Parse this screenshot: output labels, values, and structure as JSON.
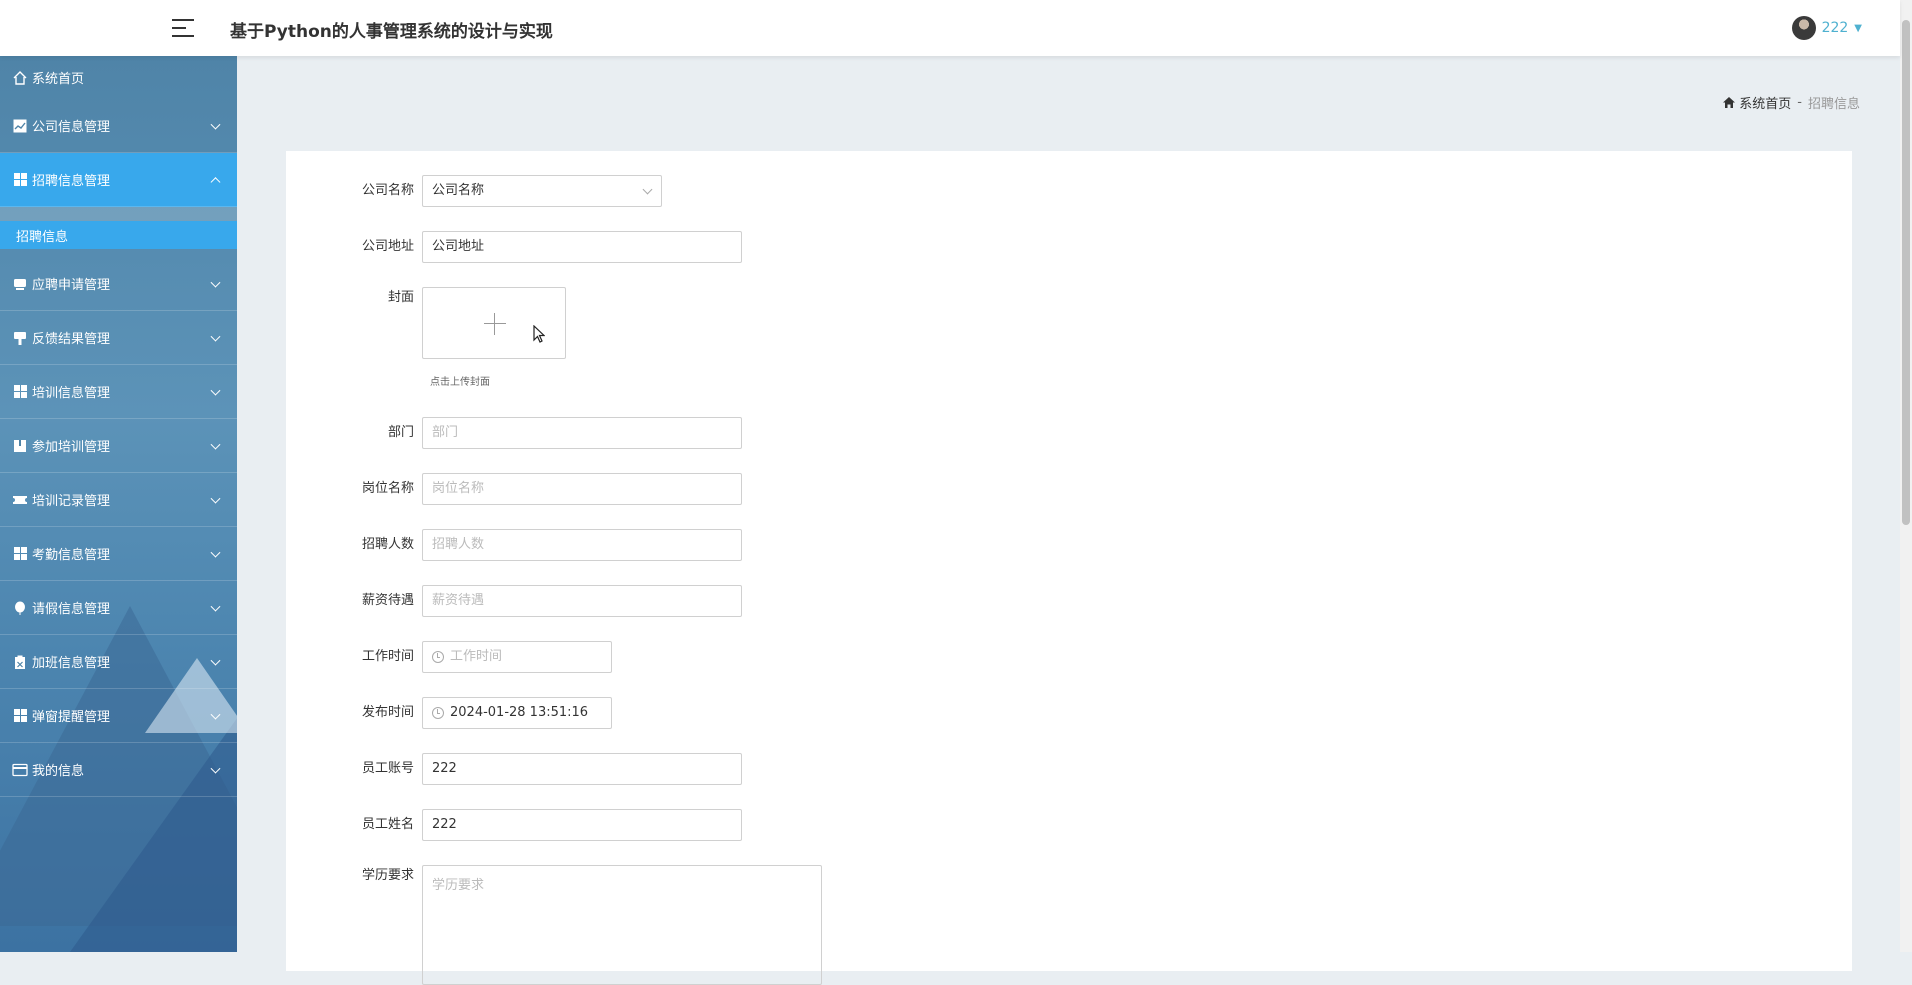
{
  "header": {
    "title": "基于Python的人事管理系统的设计与实现",
    "user": {
      "name": "222"
    }
  },
  "sidebar": {
    "home": "系统首页",
    "items": [
      {
        "label": "公司信息管理",
        "icon": "chart-icon"
      },
      {
        "label": "招聘信息管理",
        "icon": "grid-icon",
        "expanded": true,
        "children": [
          "招聘信息"
        ]
      },
      {
        "label": "应聘申请管理",
        "icon": "monitor-icon"
      },
      {
        "label": "反馈结果管理",
        "icon": "brush-icon"
      },
      {
        "label": "培训信息管理",
        "icon": "grid-icon"
      },
      {
        "label": "参加培训管理",
        "icon": "book-icon"
      },
      {
        "label": "培训记录管理",
        "icon": "ticket-icon"
      },
      {
        "label": "考勤信息管理",
        "icon": "grid-icon"
      },
      {
        "label": "请假信息管理",
        "icon": "balloon-icon"
      },
      {
        "label": "加班信息管理",
        "icon": "clipboard-icon"
      },
      {
        "label": "弹窗提醒管理",
        "icon": "grid-icon"
      },
      {
        "label": "我的信息",
        "icon": "card-icon"
      }
    ]
  },
  "breadcrumb": {
    "home": "系统首页",
    "separator": "-",
    "current": "招聘信息"
  },
  "form": {
    "company_name": {
      "label": "公司名称",
      "value": "公司名称"
    },
    "company_address": {
      "label": "公司地址",
      "value": "公司地址"
    },
    "cover": {
      "label": "封面",
      "hint": "点击上传封面"
    },
    "department": {
      "label": "部门",
      "placeholder": "部门"
    },
    "position": {
      "label": "岗位名称",
      "placeholder": "岗位名称"
    },
    "headcount": {
      "label": "招聘人数",
      "placeholder": "招聘人数"
    },
    "salary": {
      "label": "薪资待遇",
      "placeholder": "薪资待遇"
    },
    "work_time": {
      "label": "工作时间",
      "placeholder": "工作时间"
    },
    "publish_time": {
      "label": "发布时间",
      "value": "2024-01-28 13:51:16"
    },
    "employee_account": {
      "label": "员工账号",
      "value": "222"
    },
    "employee_name": {
      "label": "员工姓名",
      "value": "222"
    },
    "education": {
      "label": "学历要求",
      "placeholder": "学历要求"
    }
  },
  "colors": {
    "accent": "#38a8ec",
    "user": "#4fb1d0"
  }
}
